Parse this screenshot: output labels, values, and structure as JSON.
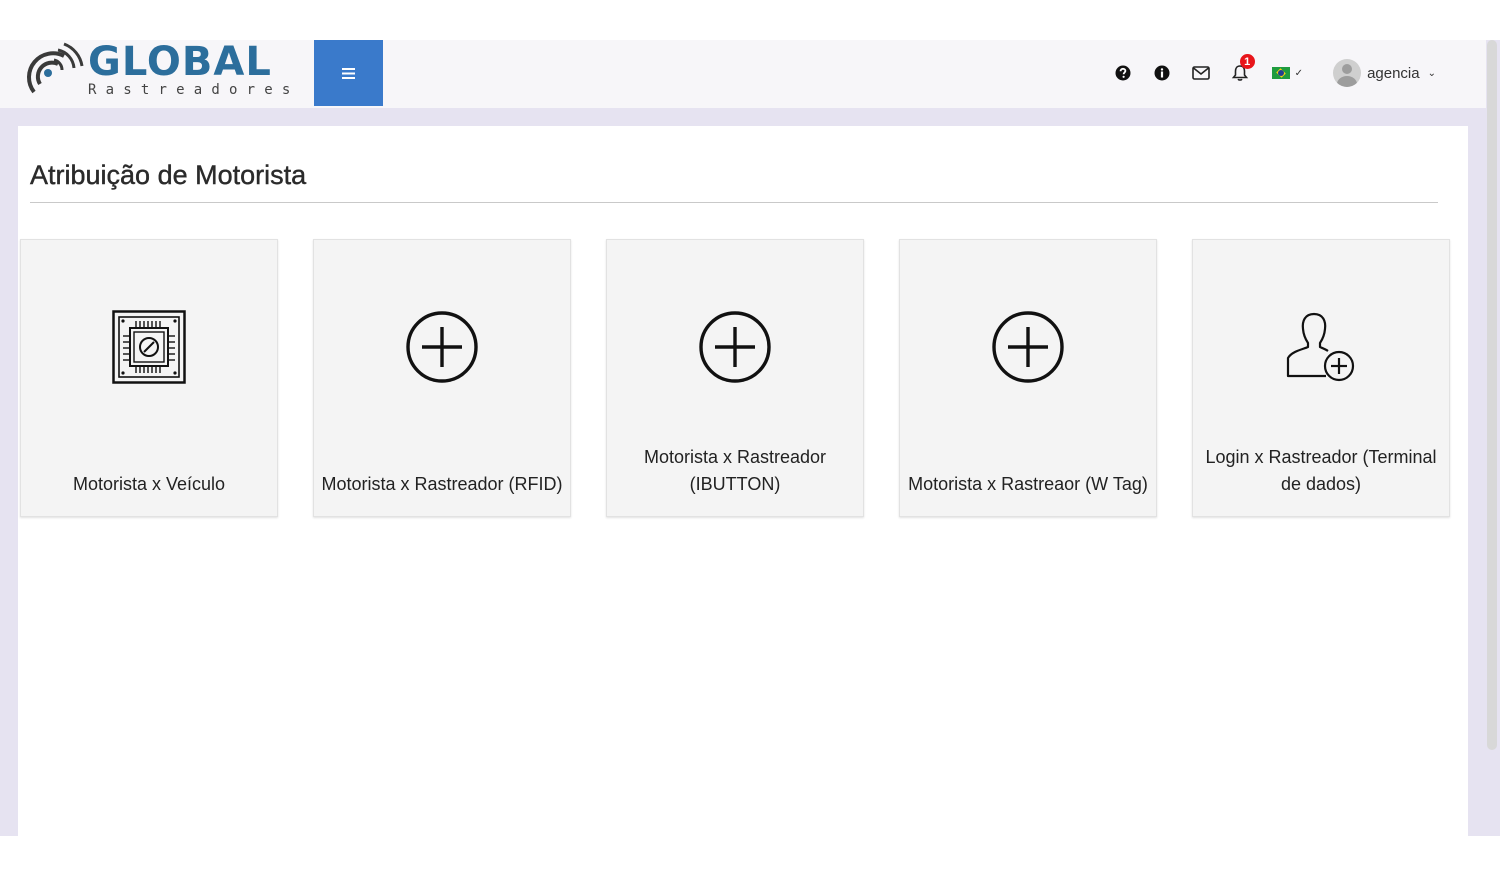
{
  "brand": {
    "name": "GLOBAL",
    "tagline": "Rastreadores",
    "color": "#2c6e9c"
  },
  "header": {
    "menu_icon": "hamburger-icon",
    "icons": [
      "help-icon",
      "info-icon",
      "mail-icon",
      "bell-icon"
    ],
    "notification_count": "1",
    "language_flag": "flag-brazil",
    "user_name": "agencia",
    "accent_color": "#3a7acb"
  },
  "page": {
    "title": "Atribuição de Motorista"
  },
  "cards": [
    {
      "label": "Motorista x Veículo",
      "icon": "chip-icon"
    },
    {
      "label": "Motorista x Rastreador (RFID)",
      "icon": "plus-circle-icon"
    },
    {
      "label": "Motorista x Rastreador (IBUTTON)",
      "icon": "plus-circle-icon"
    },
    {
      "label": "Motorista x Rastreaor (W Tag)",
      "icon": "plus-circle-icon"
    },
    {
      "label": "Login x Rastreador (Terminal de dados)",
      "icon": "add-user-icon"
    }
  ]
}
